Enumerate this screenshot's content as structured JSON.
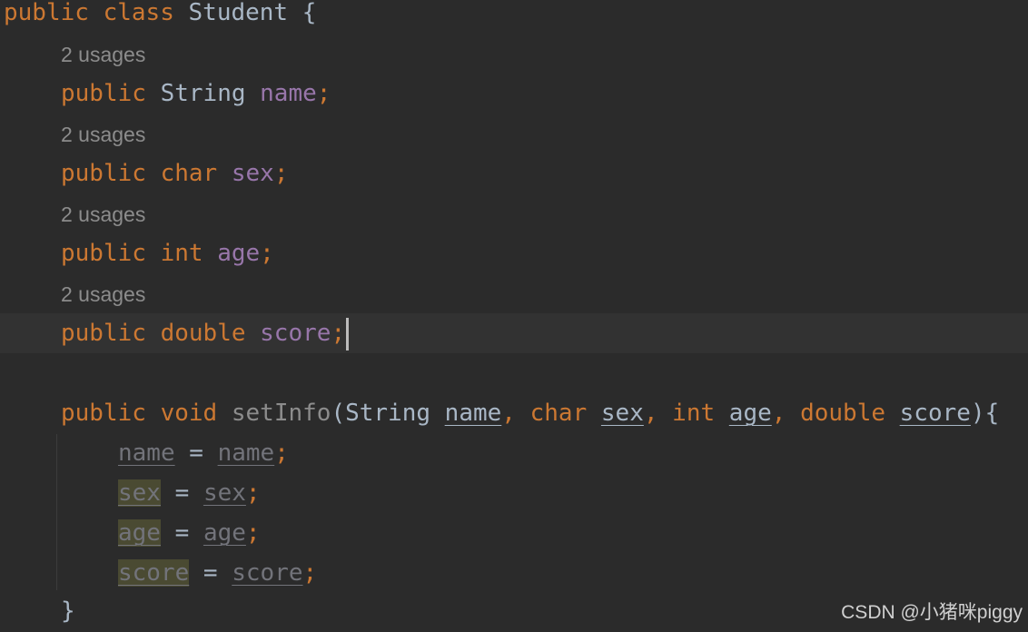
{
  "code": {
    "class_decl": {
      "kw1": "public",
      "kw2": "class",
      "name": "Student",
      "brace": "{"
    },
    "usage_hint": "2 usages",
    "fields": [
      {
        "modifier": "public",
        "type": "String",
        "name": "name",
        "semi": ";"
      },
      {
        "modifier": "public",
        "type": "char",
        "name": "sex",
        "semi": ";"
      },
      {
        "modifier": "public",
        "type": "int",
        "name": "age",
        "semi": ";"
      },
      {
        "modifier": "public",
        "type": "double",
        "name": "score",
        "semi": ";"
      }
    ],
    "method": {
      "modifier": "public",
      "return_type": "void",
      "name": "setInfo",
      "open_paren": "(",
      "params": [
        {
          "type": "String",
          "name": "name",
          "sep": ", "
        },
        {
          "type": "char",
          "name": "sex",
          "sep": ", "
        },
        {
          "type": "int",
          "name": "age",
          "sep": ", "
        },
        {
          "type": "double",
          "name": "score",
          "sep": ""
        }
      ],
      "close": "){"
    },
    "assignments": [
      {
        "left": "name",
        "op": " = ",
        "right": "name",
        "semi": ";"
      },
      {
        "left": "sex",
        "op": " = ",
        "right": "sex",
        "semi": ";"
      },
      {
        "left": "age",
        "op": " = ",
        "right": "age",
        "semi": ";"
      },
      {
        "left": "score",
        "op": " = ",
        "right": "score",
        "semi": ";"
      }
    ],
    "close_brace": "}"
  },
  "watermark": "CSDN @小猪咪piggy",
  "colors": {
    "background": "#2b2b2b",
    "current_line": "#323232",
    "keyword": "#cc7832",
    "field": "#9876aa",
    "text": "#a9b7c6",
    "hint": "#8c8c8c",
    "unused": "#72737a",
    "highlight": "#4a4a32"
  }
}
